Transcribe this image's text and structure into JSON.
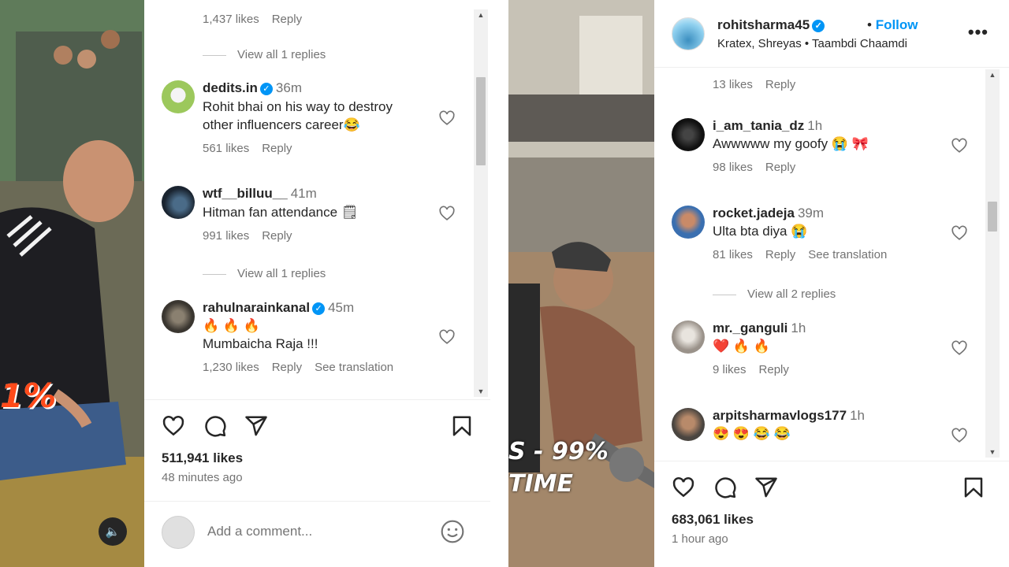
{
  "left": {
    "top_fragment": {
      "likes": "1,437 likes",
      "reply": "Reply"
    },
    "view_replies_1": "View all 1 replies",
    "comments": [
      {
        "user": "dedits.in",
        "verified": true,
        "time": "36m",
        "text": "Rohit bhai on his way to destroy other influencers career😂",
        "likes": "561 likes",
        "reply": "Reply"
      },
      {
        "user": "wtf__billuu__",
        "verified": false,
        "time": "41m",
        "text": "Hitman fan attendance 🗒",
        "likes": "991 likes",
        "reply": "Reply"
      },
      {
        "user": "rahulnarainkanal",
        "verified": true,
        "time": "45m",
        "emojis": "🔥 🔥 🔥",
        "text": "Mumbaicha Raja !!!",
        "likes": "1,230 likes",
        "reply": "Reply",
        "translate": "See translation"
      }
    ],
    "view_replies_2": "View all 1 replies",
    "likes_total": "511,941 likes",
    "posted": "48 minutes ago",
    "comment_placeholder": "Add a comment...",
    "video_overlay": "1%"
  },
  "right": {
    "header": {
      "username": "rohitsharma45",
      "follow": "Follow",
      "subtitle": "Kratex, Shreyas • Taambdi Chaamdi"
    },
    "top_fragment": {
      "likes": "13 likes",
      "reply": "Reply"
    },
    "comments": [
      {
        "user": "i_am_tania_dz",
        "time": "1h",
        "text": "Awwwww my goofy 😭 🎀",
        "likes": "98 likes",
        "reply": "Reply"
      },
      {
        "user": "rocket.jadeja",
        "time": "39m",
        "text": "Ulta bta diya 😭",
        "likes": "81 likes",
        "reply": "Reply",
        "translate": "See translation"
      },
      {
        "user": "mr._ganguli",
        "time": "1h",
        "text": "❤️ 🔥 🔥",
        "likes": "9 likes",
        "reply": "Reply"
      },
      {
        "user": "arpitsharmavlogs177",
        "time": "1h",
        "text": "😍 😍 😂 😂"
      }
    ],
    "view_replies": "View all 2 replies",
    "likes_total": "683,061 likes",
    "posted": "1 hour ago",
    "video_overlay_1": "S - 99%",
    "video_overlay_2": "TIME"
  },
  "colors": {
    "accent": "#0095f6",
    "muted": "#737373",
    "text": "#262626"
  }
}
